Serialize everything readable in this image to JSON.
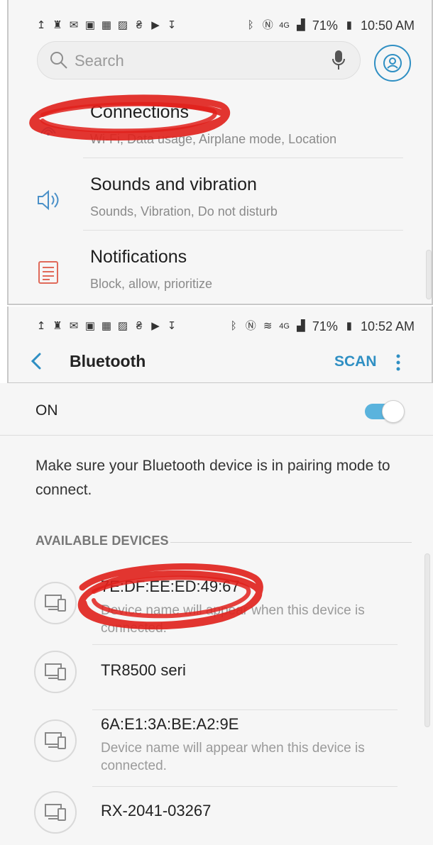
{
  "screen1": {
    "status": {
      "left_icons": [
        "upload-icon",
        "person-icon",
        "mail-icon",
        "gallery-icon",
        "calendar-icon",
        "image-icon",
        "lock-icon",
        "youtube-icon",
        "download-icon"
      ],
      "right_icons": [
        "bluetooth-icon",
        "nfc-icon",
        "signal-icon"
      ],
      "network": "4G",
      "battery": "71%",
      "time": "10:50 AM"
    },
    "search": {
      "placeholder": "Search"
    },
    "settings": [
      {
        "title": "Connections",
        "subtitle": "Wi-Fi, Data usage, Airplane mode, Location",
        "icon": "wifi-connection-icon"
      },
      {
        "title": "Sounds and vibration",
        "subtitle": "Sounds, Vibration, Do not disturb",
        "icon": "speaker-icon"
      },
      {
        "title": "Notifications",
        "subtitle": "Block, allow, prioritize",
        "icon": "notifications-icon"
      }
    ]
  },
  "screen2": {
    "status": {
      "battery": "71%",
      "time": "10:52 AM",
      "network": "4G"
    },
    "appbar": {
      "title": "Bluetooth",
      "scan_label": "SCAN"
    },
    "toggle": {
      "label": "ON",
      "state": true,
      "color": "#5ab3dd"
    },
    "hint": "Make sure your Bluetooth device is in pairing mode to connect.",
    "section_label": "AVAILABLE DEVICES",
    "devices": [
      {
        "name": "7E:DF:EE:ED:49:67",
        "subtitle": "Device name will appear when this device is connected."
      },
      {
        "name": "TR8500 seri",
        "subtitle": ""
      },
      {
        "name": "6A:E1:3A:BE:A2:9E",
        "subtitle": "Device name will appear when this device is connected."
      },
      {
        "name": "RX-2041-03267",
        "subtitle": ""
      }
    ]
  },
  "colors": {
    "accent": "#2f8fc3",
    "annotation": "#e0201b"
  }
}
